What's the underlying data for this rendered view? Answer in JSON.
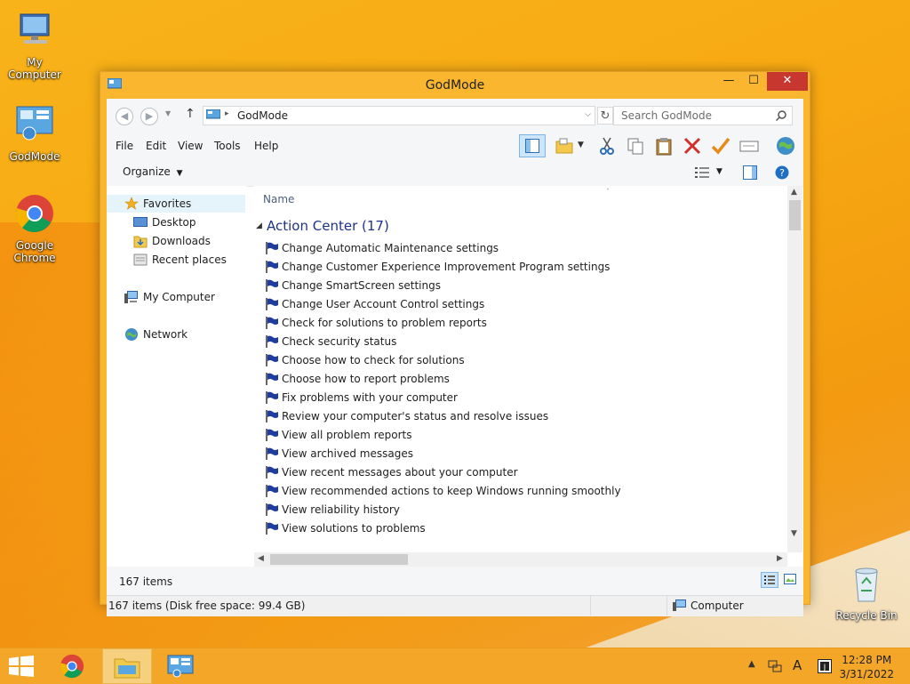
{
  "desktop": {
    "icons": [
      {
        "label": "My Computer"
      },
      {
        "label": "GodMode"
      },
      {
        "label": "Google Chrome"
      },
      {
        "label": "Recycle Bin"
      }
    ]
  },
  "window": {
    "title": "GodMode",
    "controls": {
      "minimize": "—",
      "maximize": "☐",
      "close": "✕"
    }
  },
  "address": {
    "path": "GodMode"
  },
  "search": {
    "placeholder": "Search GodMode"
  },
  "menu": {
    "file": "File",
    "edit": "Edit",
    "view": "View",
    "tools": "Tools",
    "help": "Help"
  },
  "toolbar": {
    "organize": "Organize"
  },
  "navpane": {
    "favorites": "Favorites",
    "desktop": "Desktop",
    "downloads": "Downloads",
    "recent": "Recent places",
    "computer": "My Computer",
    "network": "Network"
  },
  "content": {
    "column_name": "Name",
    "group_title": "Action Center (17)",
    "items": [
      "Change Automatic Maintenance settings",
      "Change Customer Experience Improvement Program settings",
      "Change SmartScreen settings",
      "Change User Account Control settings",
      "Check for solutions to problem reports",
      "Check security status",
      "Choose how to check for solutions",
      "Choose how to report problems",
      "Fix problems with your computer",
      "Review your computer's status and resolve issues",
      "View all problem reports",
      "View archived messages",
      "View recent messages about your computer",
      "View recommended actions to keep Windows running smoothly",
      "View reliability history",
      "View solutions to problems"
    ]
  },
  "details": {
    "count": "167 items"
  },
  "status": {
    "left": "167 items (Disk free space: 99.4 GB)",
    "right": "Computer"
  },
  "taskbar": {
    "time": "12:28 PM",
    "date": "3/31/2022",
    "lang": "A"
  },
  "colors": {
    "accent": "#f7a812",
    "link": "#1e3287",
    "close": "#c7372f"
  }
}
